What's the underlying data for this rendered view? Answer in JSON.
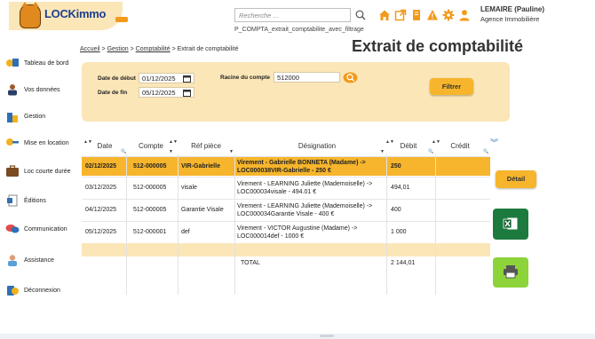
{
  "header": {
    "logo_text": "LOCKimmo",
    "search_placeholder": "Recherche ...",
    "page_name": "P_COMPTA_extrait_comptabilite_avec_filtrage",
    "user_name": "LEMAIRE (Pauline)",
    "user_agency": "Agence Immobilière",
    "accent_color": "#f29a1a"
  },
  "sidebar": {
    "items": [
      {
        "label": "Tableau de bord",
        "icon": "dashboard-icon"
      },
      {
        "label": "Vos données",
        "icon": "user-icon"
      },
      {
        "label": "Gestion",
        "icon": "buildings-icon"
      },
      {
        "label": "Mise en location",
        "icon": "key-icon"
      },
      {
        "label": "Loc courte durée",
        "icon": "suitcase-icon"
      },
      {
        "label": "Éditions",
        "icon": "document-icon"
      },
      {
        "label": "Communication",
        "icon": "chat-icon"
      },
      {
        "label": "Assistance",
        "icon": "support-icon"
      },
      {
        "label": "Déconnexion",
        "icon": "logout-icon"
      }
    ]
  },
  "breadcrumb": {
    "home": "Accueil",
    "gestion": "Gestion",
    "compta": "Comptabilité",
    "current": "Extrait de comptabilité",
    "sep": ">"
  },
  "page_title": "Extrait de comptabilité",
  "filters": {
    "date_debut_label": "Date de début",
    "date_debut_value": "01/12/2025",
    "date_fin_label": "Date de fin",
    "date_fin_value": "05/12/2025",
    "racine_label": "Racine du compte",
    "racine_value": "512000",
    "filter_button": "Filtrer"
  },
  "table": {
    "headers": [
      "Date",
      "Compte",
      "Réf pièce",
      "Désignation",
      "Débit",
      "Crédit"
    ],
    "rows": [
      {
        "date": "02/12/2025",
        "compte": "512-000005",
        "ref": "VIR-Gabrielle",
        "designation": "Virement - Gabrielle BONNETA (Madame) -> LOC000038VIR-Gabrielle - 250 €",
        "debit": "250",
        "credit": ""
      },
      {
        "date": "03/12/2025",
        "compte": "512-000005",
        "ref": "visale",
        "designation": "Virement - LEARNING Juliette (Mademoiselle) -> LOC000034visale - 494.01 €",
        "debit": "494,01",
        "credit": ""
      },
      {
        "date": "04/12/2025",
        "compte": "512-000005",
        "ref": "Garantie Visale",
        "designation": "Virement - LEARNING Juliette (Mademoiselle) -> LOC000034Garantie Visale - 400 €",
        "debit": "400",
        "credit": ""
      },
      {
        "date": "05/12/2025",
        "compte": "512-000001",
        "ref": "def",
        "designation": "Virement - VICTOR Augustine (Madame) -> LOC000014def - 1000 €",
        "debit": "1 000",
        "credit": ""
      }
    ],
    "total_label": "TOTAL",
    "total_debit": "2 144,01",
    "selected_color": "#f6b52c"
  },
  "actions": {
    "detail": "Détail",
    "excel_icon": "excel-icon",
    "print_icon": "printer-icon"
  }
}
